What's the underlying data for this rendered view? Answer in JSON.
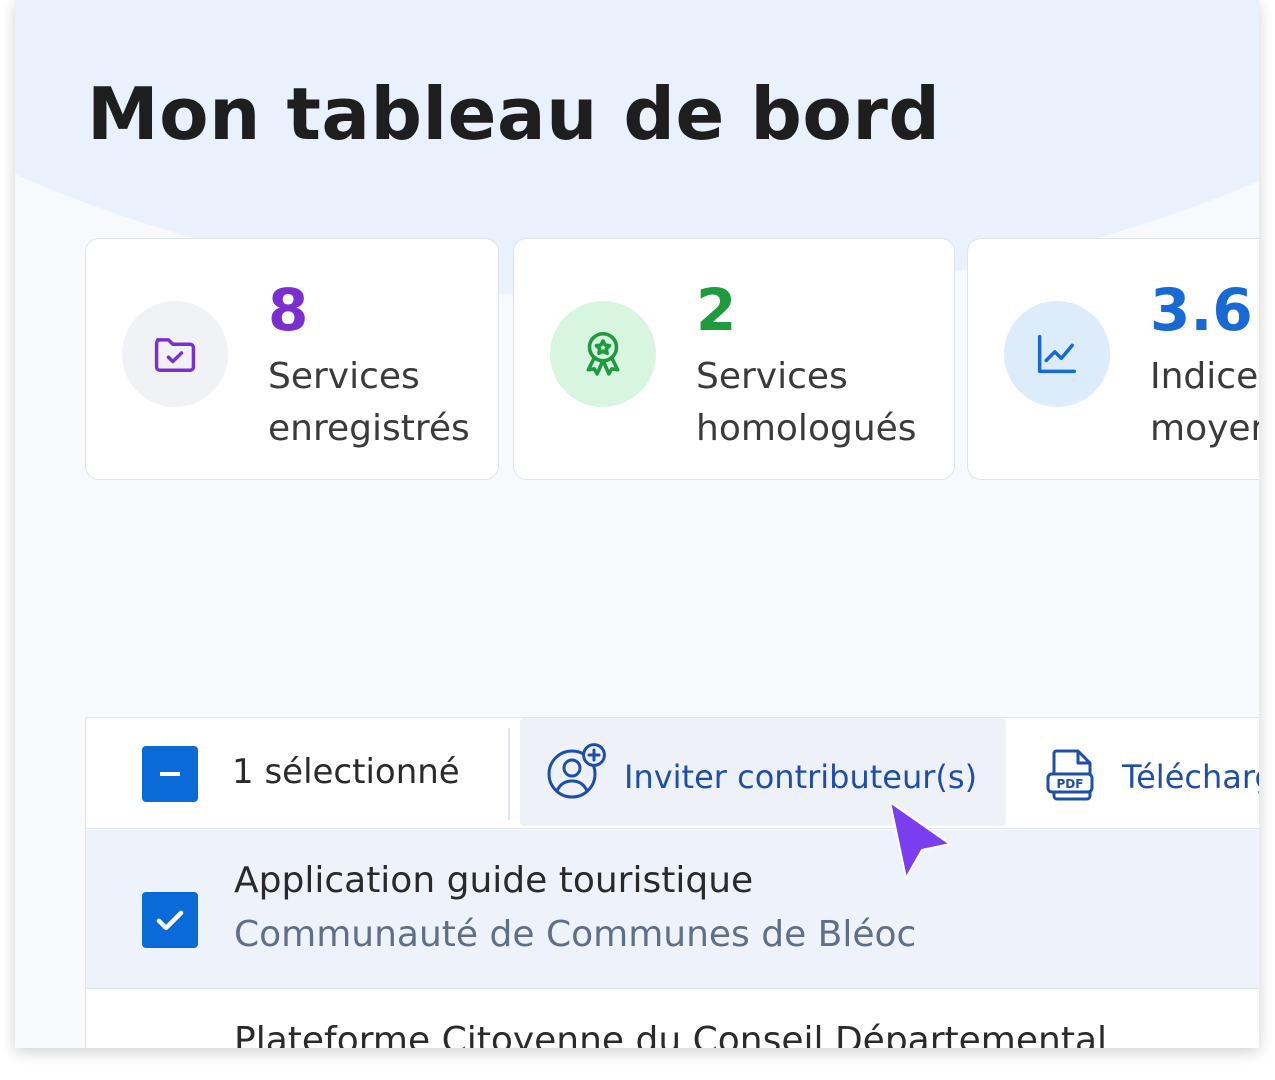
{
  "page": {
    "title": "Mon tableau de bord"
  },
  "stats": [
    {
      "value": "8",
      "label": "Services\nenregistrés",
      "value_color": "#7b2fd0",
      "icon": "folder-check-icon",
      "icon_bg": "#f0f2f6"
    },
    {
      "value": "2",
      "label": "Services\nhomologués",
      "value_color": "#1f9a3f",
      "icon": "award-icon",
      "icon_bg": "#d7f5df"
    },
    {
      "value": "3.6",
      "label": "Indice\nmoyen",
      "value_color": "#1869d3",
      "icon": "line-chart-icon",
      "icon_bg": "#dcecfb"
    }
  ],
  "toolbar": {
    "selection_text": "1 sélectionné",
    "invite_label": "Inviter contributeur(s)",
    "download_label": "Télécharger"
  },
  "rows": [
    {
      "title": "Application guide touristique",
      "subtitle": "Communauté de Communes de Bléoc",
      "selected": true
    },
    {
      "title": "Plateforme Citoyenne du Conseil Départemental",
      "subtitle": "",
      "selected": false
    }
  ],
  "colors": {
    "accent": "#0a6ad8",
    "cursor": "#7a3df0"
  }
}
